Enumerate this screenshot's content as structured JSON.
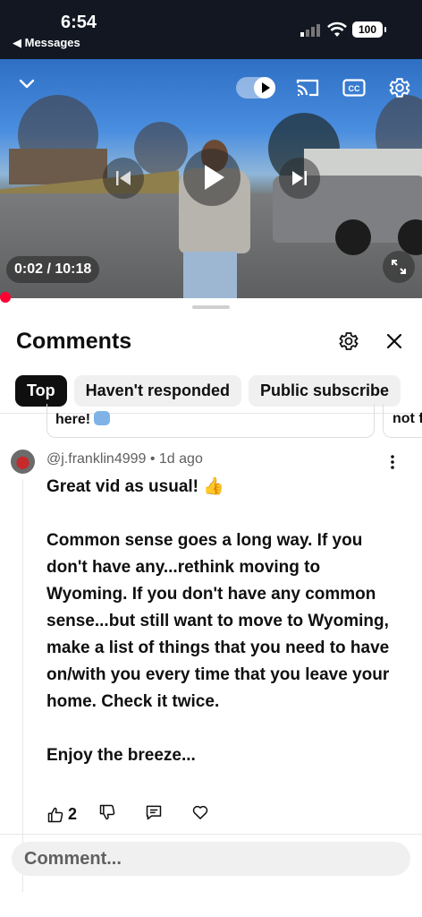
{
  "status_bar": {
    "time": "6:54",
    "back_label": "◀ Messages",
    "battery": "100"
  },
  "video": {
    "timecode": "0:02 / 10:18"
  },
  "comments_panel": {
    "title": "Comments",
    "chips": [
      "Top",
      "Haven't responded",
      "Public subscribe"
    ]
  },
  "previous_card": {
    "text": "here!"
  },
  "next_card": {
    "text": "not f"
  },
  "comment": {
    "author_meta": "@j.franklin4999 • 1d ago",
    "text": "Great vid as usual! 👍\n\nCommon sense goes a long way. If you don't have any...rethink moving to Wyoming. If you don't have any common sense...but still want to move to Wyoming, make a list of things that you need to have on/with you every time that you leave your home. Check it twice.\n\nEnjoy the breeze...",
    "like_count": "2"
  },
  "comment_input": {
    "placeholder": "Comment..."
  },
  "colors": {
    "accent": "#ff0033",
    "chip_active": "#0f0f0f",
    "chip_bg": "#f0f0f0"
  }
}
